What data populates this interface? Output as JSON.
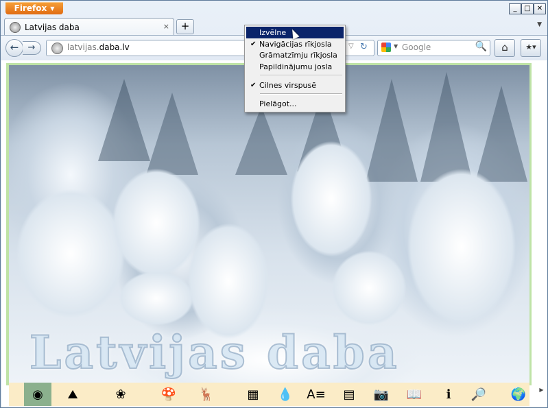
{
  "browser": {
    "app_button": "Firefox",
    "window_controls": {
      "minimize": "_",
      "maximize": "□",
      "close": "✕"
    }
  },
  "tab": {
    "title": "Latvijas daba",
    "close": "×"
  },
  "newtab_label": "+",
  "nav": {
    "back": "←",
    "forward": "→",
    "url_prefix": "latvijas.",
    "url_host": "daba.lv",
    "reload": "↻",
    "url_dropdown": "▽"
  },
  "search": {
    "placeholder": "Google",
    "go": "🔍"
  },
  "home": "⌂",
  "bookmarks": "★▾",
  "page": {
    "watermark": "Latvijas daba",
    "iconbar": [
      {
        "name": "home-nav-icon",
        "glyph": "◉"
      },
      {
        "name": "landscape-icon",
        "glyph": "⛰"
      },
      {
        "name": "flower-icon",
        "glyph": "❀"
      },
      {
        "name": "mushroom-icon",
        "glyph": "🍄"
      },
      {
        "name": "animal-icon",
        "glyph": "🦌"
      },
      {
        "name": "map-icon",
        "glyph": "▦"
      },
      {
        "name": "water-icon",
        "glyph": "💧"
      },
      {
        "name": "dictionary-icon",
        "glyph": "A≡"
      },
      {
        "name": "table-icon",
        "glyph": "▤"
      },
      {
        "name": "camera-icon",
        "glyph": "📷"
      },
      {
        "name": "book-icon",
        "glyph": "📖"
      },
      {
        "name": "info-icon",
        "glyph": "ℹ"
      },
      {
        "name": "search-page-icon",
        "glyph": "🔎"
      },
      {
        "name": "globe-icon",
        "glyph": "🌍"
      }
    ]
  },
  "context_menu": {
    "items": [
      {
        "label": "Izvēlne",
        "checked": false,
        "highlighted": true
      },
      {
        "label": "Navigācijas rīkjosla",
        "checked": true
      },
      {
        "label": "Grāmatzīmju rīkjosla",
        "checked": false
      },
      {
        "label": "Papildinājumu josla",
        "checked": false
      },
      {
        "label": "Cilnes virspusē",
        "checked": true
      },
      {
        "label": "Pielāgot...",
        "checked": false
      }
    ],
    "check_glyph": "✔"
  }
}
